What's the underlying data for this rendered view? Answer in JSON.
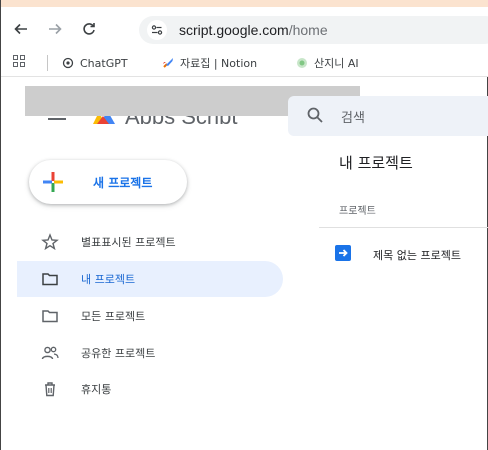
{
  "browser": {
    "url_host": "script.google.com",
    "url_path": "/home",
    "bookmarks": [
      {
        "label": "ChatGPT",
        "icon": "chatgpt-icon"
      },
      {
        "label": "자료집 | Notion",
        "icon": "rocket-icon"
      },
      {
        "label": "산지니 AI",
        "icon": "globe-icon"
      }
    ]
  },
  "header": {
    "app_title": "Apps Script",
    "search_placeholder": "검색"
  },
  "sidebar": {
    "new_project_label": "새 프로젝트",
    "items": [
      {
        "label": "별표표시된 프로젝트",
        "icon": "star-icon",
        "active": false
      },
      {
        "label": "내 프로젝트",
        "icon": "folder-icon",
        "active": true
      },
      {
        "label": "모든 프로젝트",
        "icon": "folder-icon",
        "active": false
      },
      {
        "label": "공유한 프로젝트",
        "icon": "people-icon",
        "active": false
      },
      {
        "label": "휴지통",
        "icon": "trash-icon",
        "active": false
      }
    ]
  },
  "main": {
    "title": "내 프로젝트",
    "column_header": "프로젝트",
    "projects": [
      {
        "name": "제목 없는 프로젝트",
        "icon": "apps-script-file-icon"
      }
    ]
  },
  "colors": {
    "accent": "#1a73e8",
    "active_bg": "#e8f0fe",
    "top_strip": "#fbe3cf"
  }
}
